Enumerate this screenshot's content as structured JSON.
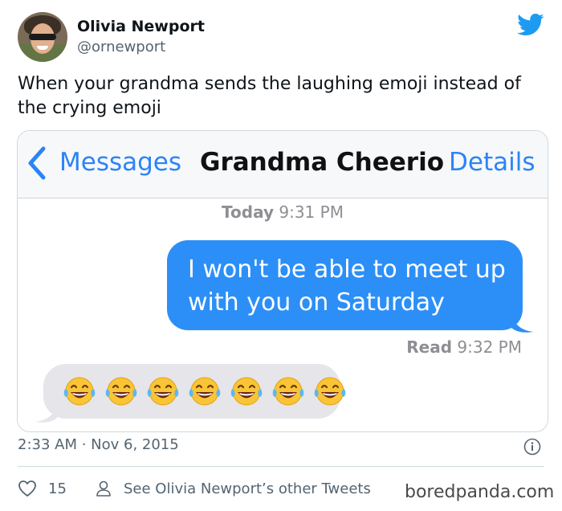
{
  "tweet": {
    "author": {
      "display_name": "Olivia Newport",
      "handle": "@ornewport"
    },
    "text": "When your grandma sends the laughing emoji instead of the crying emoji",
    "date": "2:33 AM · Nov 6, 2015",
    "likes": "15",
    "profile_link": "See Olivia Newport’s other Tweets",
    "brand_color": "#1d9bf0"
  },
  "imessage": {
    "back_label": "Messages",
    "contact_name": "Grandma Cheerio",
    "details_label": "Details",
    "timestamp_day": "Today",
    "timestamp_time": "9:31 PM",
    "sent_message": "I won't be able to meet up with you on Saturday",
    "read_label": "Read",
    "read_time": "9:32 PM",
    "received_emoji": [
      "laughing-emoji",
      "laughing-emoji",
      "laughing-emoji",
      "laughing-emoji",
      "laughing-emoji",
      "laughing-emoji",
      "laughing-emoji"
    ],
    "accent_color": "#2b84f5",
    "sent_bubble_color": "#2c8ff7",
    "received_bubble_color": "#e5e5ea"
  },
  "watermark": "boredpanda.com"
}
